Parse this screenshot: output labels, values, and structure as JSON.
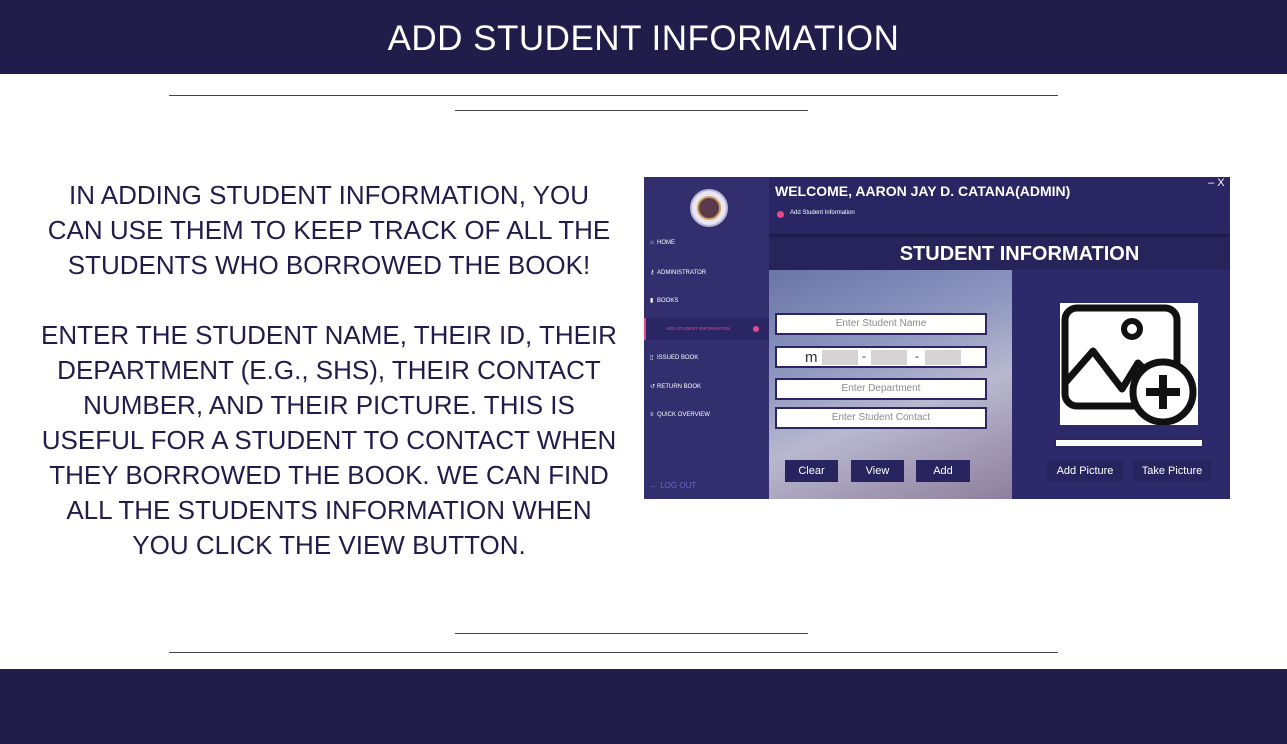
{
  "header": {
    "title": "ADD STUDENT INFORMATION"
  },
  "description": {
    "paragraph_1": "IN ADDING STUDENT INFORMATION, YOU CAN USE THEM TO KEEP TRACK OF ALL THE STUDENTS WHO BORROWED THE BOOK!",
    "paragraph_2": "ENTER THE STUDENT NAME, THEIR ID, THEIR DEPARTMENT (E.G., SHS), THEIR CONTACT NUMBER, AND THEIR PICTURE. THIS IS USEFUL FOR A STUDENT TO CONTACT WHEN THEY BORROWED THE BOOK. WE CAN FIND ALL THE STUDENTS INFORMATION WHEN YOU CLICK THE VIEW BUTTON."
  },
  "app": {
    "welcome": "WELCOME, AARON JAY D. CATANA(ADMIN)",
    "breadcrumb": "Add Student Information",
    "window_controls": {
      "minimize": "–",
      "close": "X"
    },
    "sidebar": {
      "items": [
        {
          "icon": "home-icon",
          "glyph": "⌂",
          "label": "HOME"
        },
        {
          "icon": "key-icon",
          "glyph": "⚷",
          "label": "ADMINISTRATOR"
        },
        {
          "icon": "book-icon",
          "glyph": "▮",
          "label": "BOOKS"
        },
        {
          "icon": "bookmark-icon",
          "glyph": "▯",
          "label": "ISSUED BOOK"
        },
        {
          "icon": "return-icon",
          "glyph": "↺",
          "label": "RETURN BOOK"
        },
        {
          "icon": "list-icon",
          "glyph": "≡",
          "label": "QUICK OVERVIEW"
        }
      ],
      "active_item": "ADD STUDENT INFORMATION",
      "logout": "← LOG OUT"
    },
    "banner_title": "STUDENT INFORMATION",
    "form": {
      "name_placeholder": "Enter Student Name",
      "id_prefix": "m",
      "id_separator": "-",
      "department_placeholder": "Enter Department",
      "contact_placeholder": "Enter Student Contact",
      "buttons": {
        "clear": "Clear",
        "view": "View",
        "add": "Add"
      }
    },
    "picture": {
      "icon": "add-image-icon",
      "buttons": {
        "add_picture": "Add Picture",
        "take_picture": "Take Picture"
      }
    },
    "colors": {
      "navy": "#201d4b",
      "panel": "#2a2663",
      "accent": "#e24a8a"
    }
  }
}
